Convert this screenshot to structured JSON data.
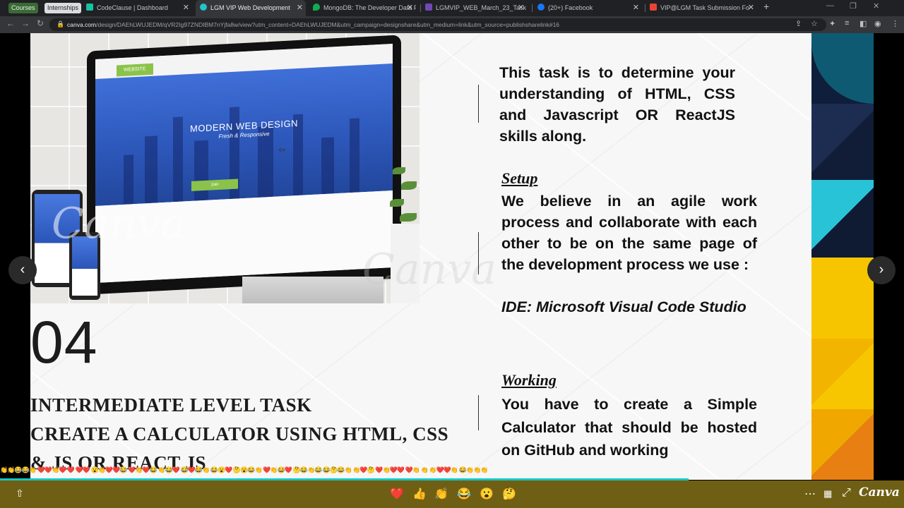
{
  "bookmarks": [
    {
      "label": "Courses"
    },
    {
      "label": "Internships"
    }
  ],
  "tabs": [
    {
      "label": "CodeClause | Dashboard",
      "favicon_color": "#19c2a0"
    },
    {
      "label": "LGM VIP Web Development",
      "favicon_color": "#20c4cb"
    },
    {
      "label": "MongoDB: The Developer Data P",
      "favicon_color": "#13aa52"
    },
    {
      "label": "LGMVIP_WEB_March_23_Task Su",
      "favicon_color": "#7248b9"
    },
    {
      "label": "(20+) Facebook",
      "favicon_color": "#1877f2"
    },
    {
      "label": "VIP@LGM Task Submission Fo",
      "favicon_color": "#ea4335"
    }
  ],
  "address_bar": {
    "domain": "canva.com",
    "url": "/design/DAEhLWUJEDM/qVR2Ig97ZNDIBM7nYjfa8w/view?utm_content=DAEhLWUJEDM&utm_campaign=designshare&utm_medium=link&utm_source=publishsharelink#16"
  },
  "slide": {
    "mockup": {
      "site_badge": "WEBSITE",
      "hero_title": "MODERN WEB DESIGN",
      "hero_subtitle": "Fresh & Responsive",
      "hero_button": "Join"
    },
    "watermark": "Canva",
    "number": "04",
    "title_lines": [
      "INTERMEDIATE LEVEL TASK",
      "CREATE A CALCULATOR USING HTML, CSS",
      "& JS OR REACT JS"
    ],
    "intro": "This task is to determine your understanding  of HTML, CSS and Javascript OR ReactJS skills along.",
    "setup_heading": "Setup ",
    "setup_text": "We believe in an agile work process and collaborate with each other to be on the same page of the development process we use :",
    "ide_text": "IDE: Microsoft Visual Code Studio",
    "working_heading": "Working ",
    "working_text": "You have to create a Simple Calculator that should be hosted on GitHub and working"
  },
  "progress": 0.762,
  "reaction_stream": "👏👏😂😂👏 ❤️❤️👏❤️  ❤️  ❤️❤️   😮👏❤️❤️😂  ❤️👏❤️😂  👏😂❤️  😂❤️😂👏  😂😮❤️  🤔😮😂👏  ❤️👏😂❤️  🤔😂👏😂  😂🤔😂👏  👏❤️🤔  ❤️👏❤️❤️  ❤️👏   👏  👏❤️❤️👏  😂👏👏👏",
  "bottom_bar": {
    "reactions": [
      {
        "icon": "heart",
        "glyph": "❤️"
      },
      {
        "icon": "thumbs-up",
        "glyph": "👍"
      },
      {
        "icon": "clap",
        "glyph": "👏"
      },
      {
        "icon": "laugh",
        "glyph": "😂"
      },
      {
        "icon": "surprised",
        "glyph": "😮"
      },
      {
        "icon": "thinking",
        "glyph": "🤔"
      }
    ],
    "brand": "Canva"
  }
}
